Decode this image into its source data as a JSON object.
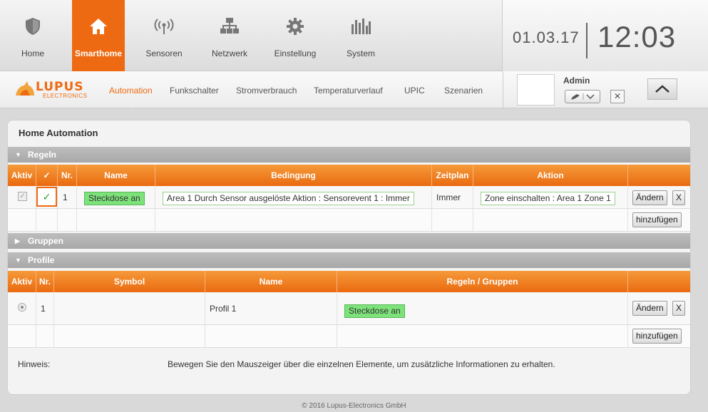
{
  "topnav": {
    "items": [
      {
        "label": "Home",
        "icon": "shield-icon"
      },
      {
        "label": "Smarthome",
        "icon": "home-icon"
      },
      {
        "label": "Sensoren",
        "icon": "antenna-icon"
      },
      {
        "label": "Netzwerk",
        "icon": "network-icon"
      },
      {
        "label": "Einstellung",
        "icon": "gear-icon"
      },
      {
        "label": "System",
        "icon": "equalizer-icon"
      }
    ],
    "active": "Smarthome",
    "accent": "#ee6a12"
  },
  "clock": {
    "date": "01.03.17",
    "time": "12:03"
  },
  "subnav": {
    "logo_text": "LUPUS",
    "logo_sub": "ELECTRONICS",
    "tabs": [
      "Automation",
      "Funkschalter",
      "Stromverbrauch",
      "Temperaturverlauf",
      "UPIC",
      "Szenarien"
    ],
    "active": "Automation"
  },
  "user": {
    "name": "Admin"
  },
  "panel": {
    "title": "Home Automation",
    "rules_section": "Regeln",
    "groups_section": "Gruppen",
    "profiles_section": "Profile",
    "rules_headers": {
      "aktiv": "Aktiv",
      "check": "✓",
      "nr": "Nr.",
      "name": "Name",
      "bedingung": "Bedingung",
      "zeitplan": "Zeitplan",
      "aktion": "Aktion"
    },
    "rules": [
      {
        "nr": "1",
        "name": "Steckdose an",
        "bedingung": "Area 1 Durch Sensor ausgelöste Aktion : Sensorevent 1 : Immer",
        "zeitplan": "Immer",
        "aktion": "Zone einschalten : Area 1 Zone 1"
      }
    ],
    "profiles_headers": {
      "aktiv": "Aktiv",
      "nr": "Nr.",
      "symbol": "Symbol",
      "name": "Name",
      "regeln": "Regeln / Gruppen"
    },
    "profiles": [
      {
        "nr": "1",
        "name": "Profil 1",
        "regeln": "Steckdose an"
      }
    ],
    "buttons": {
      "edit": "Ändern",
      "delete": "X",
      "add": "hinzufügen"
    },
    "hint_label": "Hinweis:",
    "hint_text": "Bewegen Sie den Mauszeiger über die einzelnen Elemente, um zusätzliche Informationen zu erhalten."
  },
  "footer": "© 2016 Lupus-Electronics GmbH"
}
